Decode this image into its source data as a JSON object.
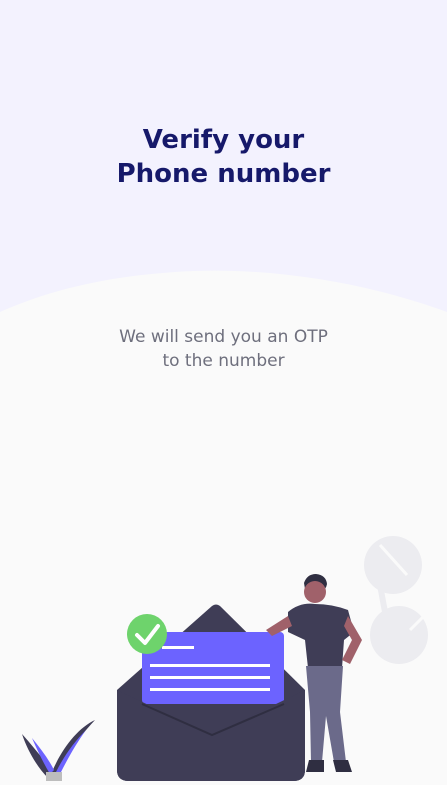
{
  "screen": {
    "title_line1": "Verify your",
    "title_line2": "Phone number",
    "subtitle_line1": "We will send you an OTP",
    "subtitle_line2": "to the number"
  },
  "colors": {
    "header_bg": "#f3f2fe",
    "page_bg": "#fafafa",
    "title": "#16196a",
    "subtitle": "#6e6f7d",
    "accent": "#6c63ff",
    "check_green": "#6ed36c",
    "envelope_dark": "#3f3d56"
  },
  "icons": {
    "check": "check-icon",
    "envelope": "envelope-icon",
    "person": "person-illustration",
    "plant": "plant-illustration"
  }
}
